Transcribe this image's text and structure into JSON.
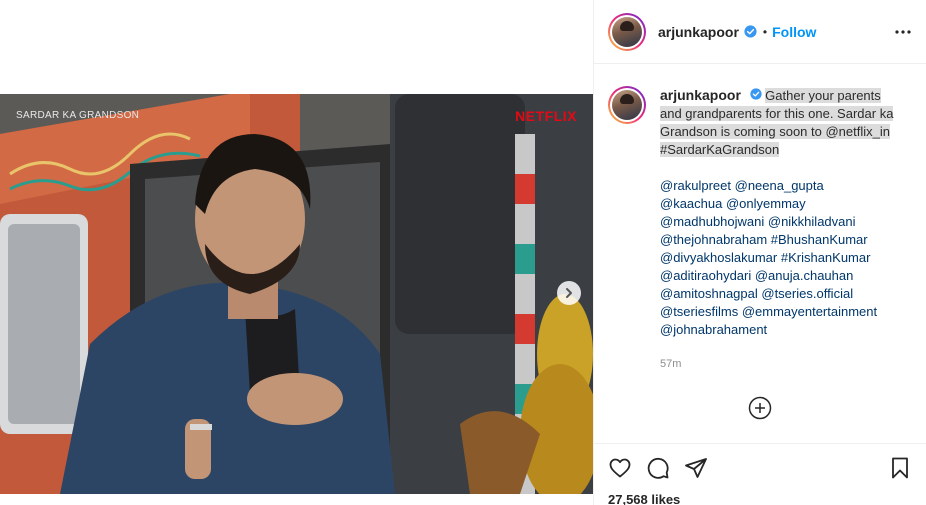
{
  "post": {
    "overlay_title": "SARDAR KA GRANDSON",
    "overlay_brand": "NETFLIX"
  },
  "header": {
    "username": "arjunkapoor",
    "separator": "•",
    "follow_label": "Follow"
  },
  "caption": {
    "username": "arjunkapoor",
    "text": "Gather your parents and grandparents for this one. Sardar ka Grandson is coming soon to @netflix_in #SardarKaGrandson",
    "tag_lines": [
      "@rakulpreet @neena_gupta",
      "@kaachua @onlyemmay",
      "@madhubhojwani @nikkhiladvani",
      "@thejohnabraham #BhushanKumar",
      "@divyakhoslakumar #KrishanKumar",
      "@aditiraohydari @anuja.chauhan",
      "@amitoshnagpal @tseries.official",
      "@tseriesfilms @emmayentertainment",
      "@johnabrahament"
    ],
    "time_ago": "57m"
  },
  "footer": {
    "likes_text": "27,568 likes"
  },
  "icons": {
    "verified": "verified-badge-icon",
    "more": "more-options-icon",
    "like": "heart-icon",
    "comment": "comment-icon",
    "share": "share-icon",
    "save": "bookmark-icon",
    "next": "chevron-right-icon",
    "load_more": "plus-circle-icon"
  },
  "colors": {
    "accent": "#0095f6",
    "verified": "#3897f0",
    "link": "#00376b",
    "muted": "#8e8e8e",
    "brand_red": "#e50914",
    "selection": "#dcdcdc"
  }
}
